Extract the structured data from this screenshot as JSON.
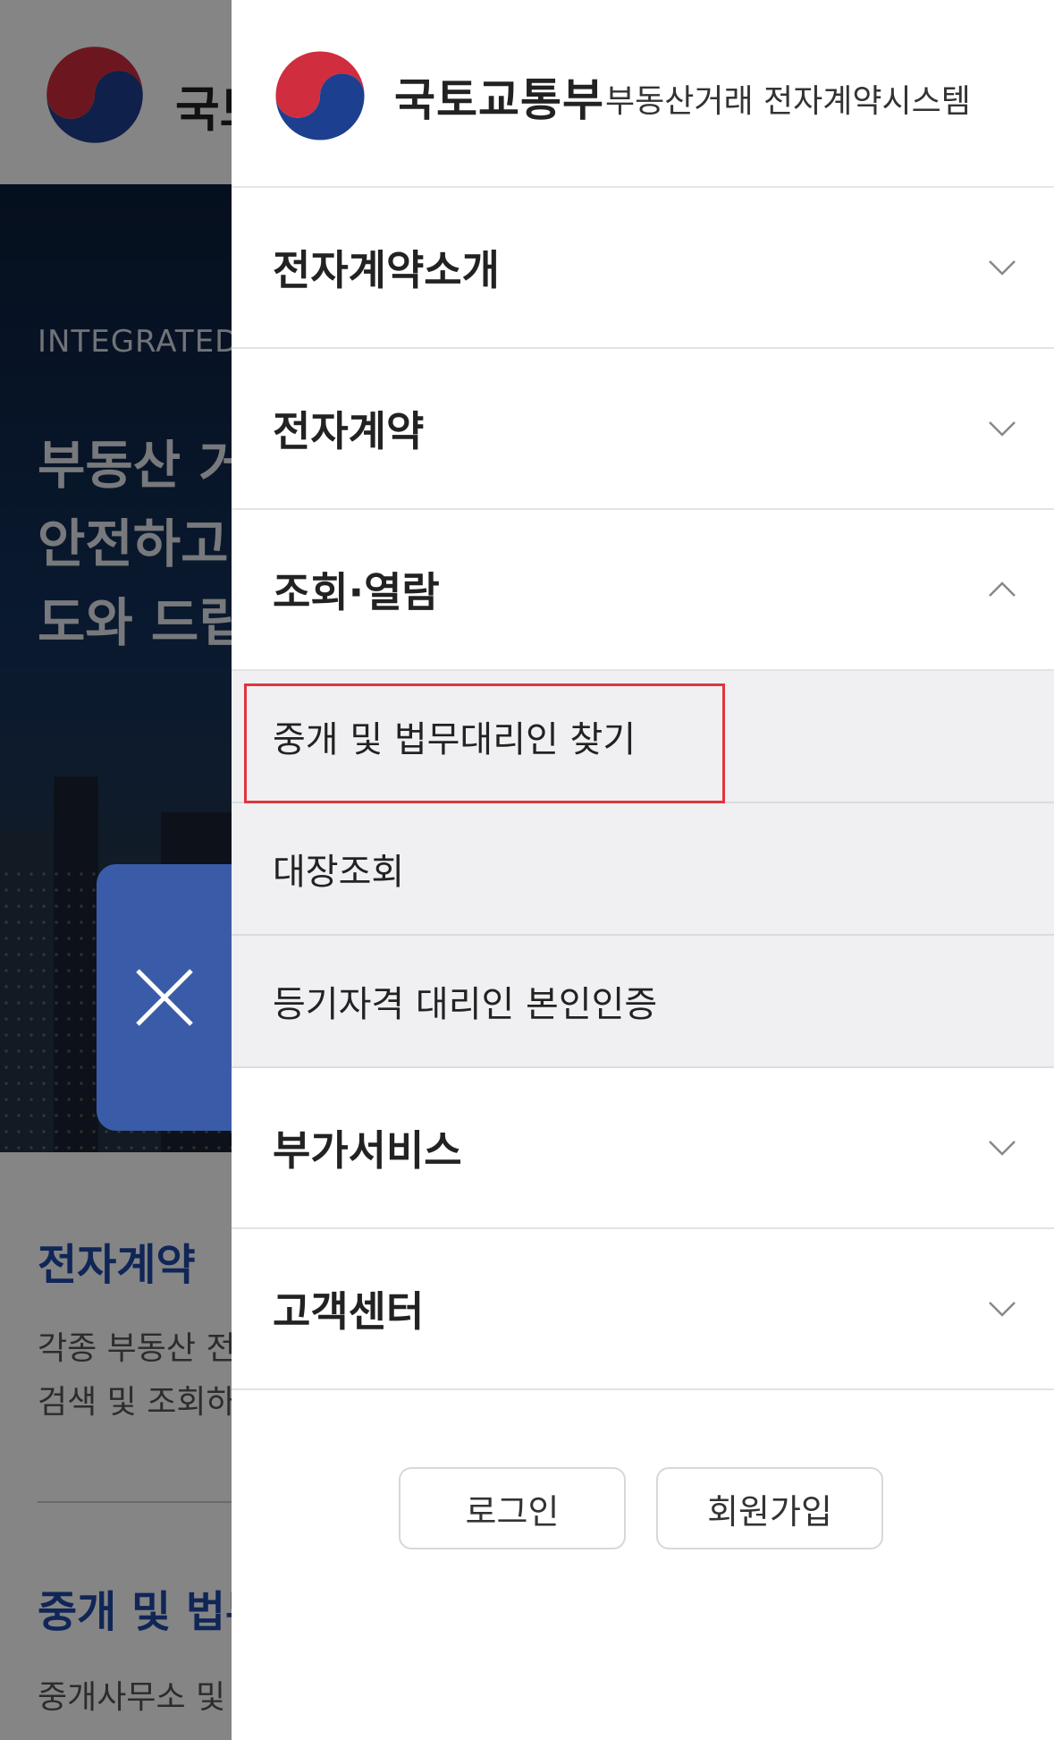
{
  "background": {
    "brand_partial": "국토",
    "hero": {
      "eyebrow": "INTEGRATED",
      "headline_lines": [
        "부동산 거",
        "안전하고",
        "도와 드립"
      ]
    },
    "sections": [
      {
        "title": "전자계약",
        "lines": [
          "각종 부동산 전자",
          "검색 및 조회하"
        ]
      },
      {
        "title": "중개 및 법무",
        "lines": [
          "중개사무소 및 법"
        ]
      }
    ]
  },
  "drawer": {
    "brand_name": "국토교통부",
    "brand_sub": "부동산거래 전자계약시스템",
    "menu": [
      {
        "label": "전자계약소개",
        "state": "collapsed"
      },
      {
        "label": "전자계약",
        "state": "collapsed"
      },
      {
        "label": "조회·열람",
        "state": "expanded",
        "children": [
          "중개 및 법무대리인 찾기",
          "대장조회",
          "등기자격 대리인 본인인증"
        ]
      },
      {
        "label": "부가서비스",
        "state": "collapsed"
      },
      {
        "label": "고객센터",
        "state": "collapsed"
      }
    ],
    "login_label": "로그인",
    "signup_label": "회원가입"
  },
  "colors": {
    "accent_blue": "#3a5ca8",
    "highlight_red": "#e0353c",
    "submenu_bg": "#f0f0f2",
    "emblem_red": "#d02d3f",
    "emblem_blue": "#1d3f8f"
  },
  "icons": {
    "close": "close-icon",
    "collapsed": "chevron-down-icon",
    "expanded": "chevron-up-icon",
    "logo": "taegeuk-emblem-icon"
  }
}
